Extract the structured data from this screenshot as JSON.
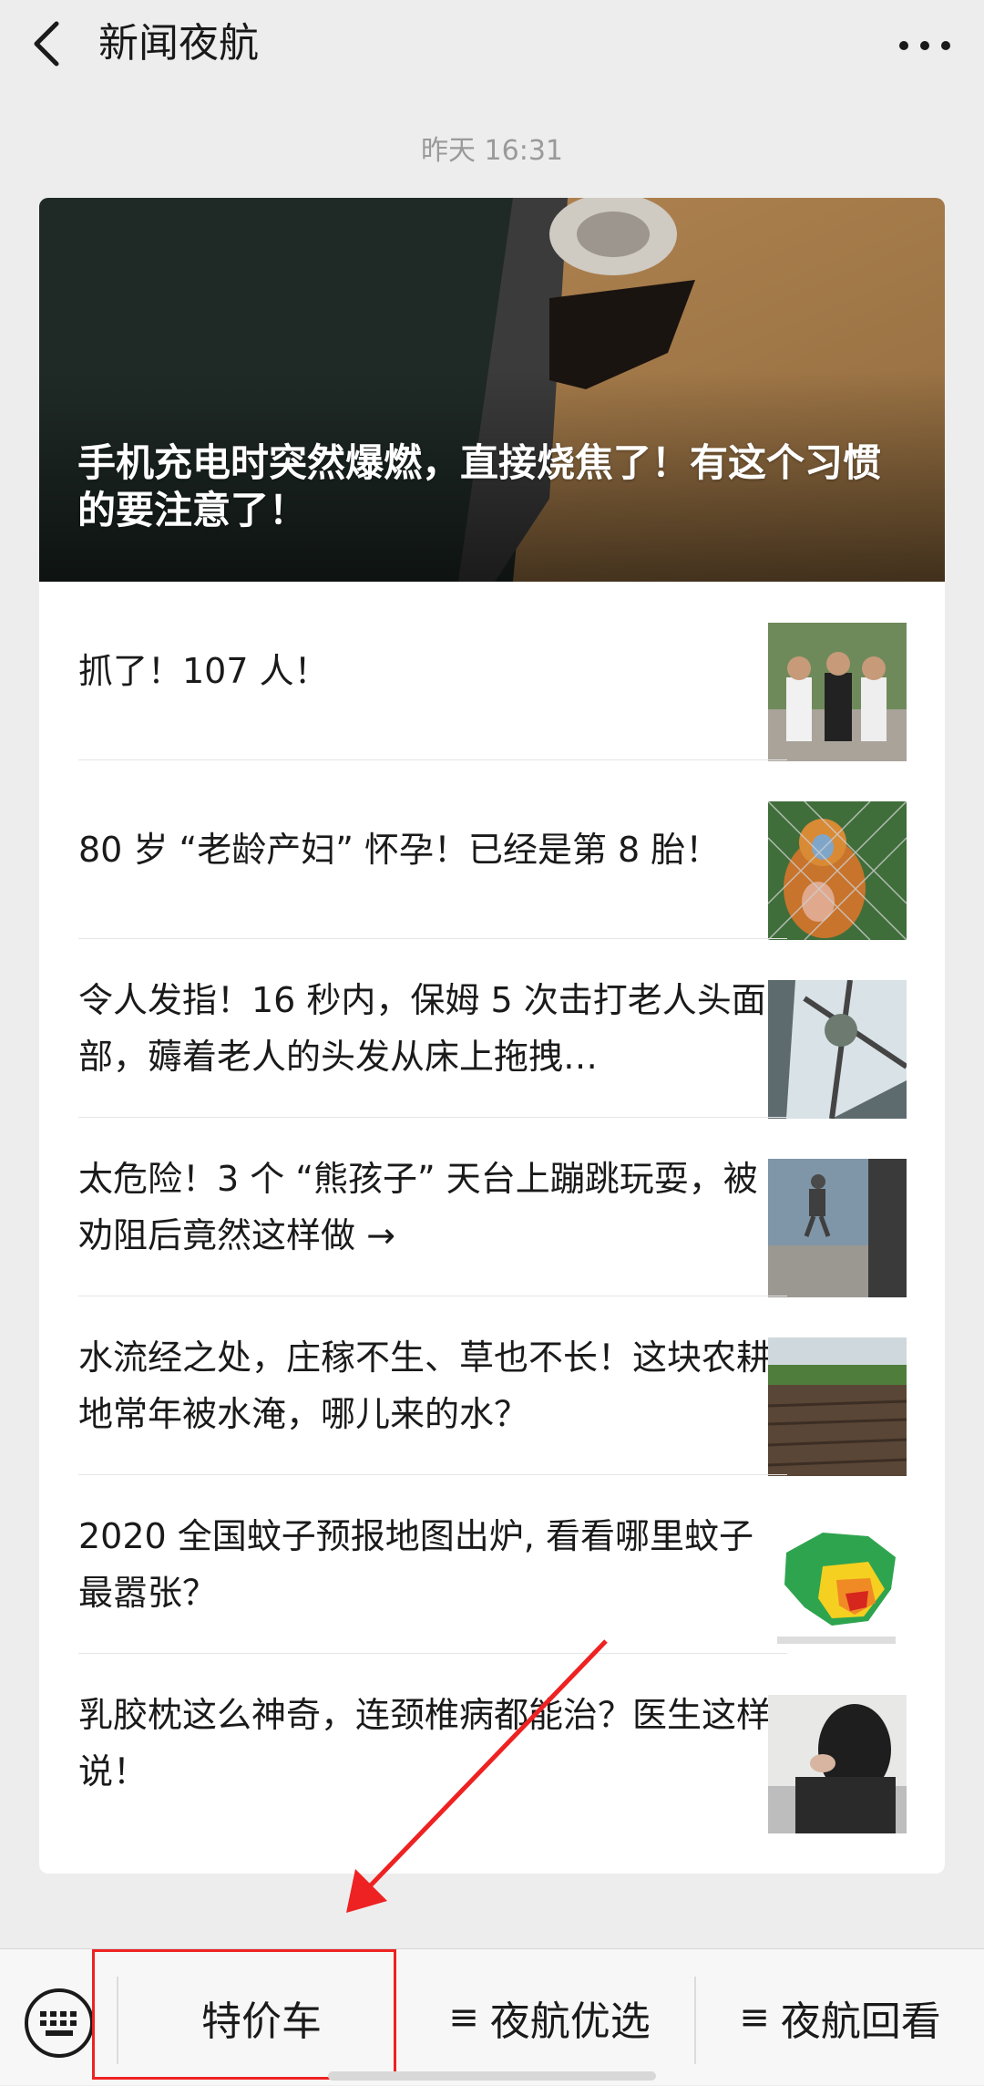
{
  "header": {
    "title": "新闻夜航",
    "back_icon": "chevron-left-icon",
    "more_icon": "more-dots-icon"
  },
  "timestamp": "昨天 16:31",
  "hero": {
    "title": "手机充电时突然爆燃，直接烧焦了！有这个习惯的要注意了！"
  },
  "articles": [
    {
      "title": "抓了！107 人！"
    },
    {
      "title": "80 岁 “老龄产妇” 怀孕！已经是第 8 胎！"
    },
    {
      "title": "令人发指！16 秒内，保姆 5 次击打老人头面部，薅着老人的头发从床上拖拽…"
    },
    {
      "title": "太危险！3 个 “熊孩子” 天台上蹦跳玩耍，被劝阻后竟然这样做 →"
    },
    {
      "title": "水流经之处，庄稼不生、草也不长！这块农耕地常年被水淹，哪儿来的水？"
    },
    {
      "title": "2020 全国蚊子预报地图出炉, 看看哪里蚊子最嚣张？"
    },
    {
      "title": "乳胶枕这么神奇，连颈椎病都能治？医生这样说！"
    }
  ],
  "bottom_menu": {
    "keyboard_icon": "keyboard-icon",
    "items": [
      {
        "label": "特价车",
        "has_submenu": false
      },
      {
        "label": "夜航优选",
        "has_submenu": true
      },
      {
        "label": "夜航回看",
        "has_submenu": true
      }
    ],
    "submenu_marker": "≡"
  },
  "annotation": {
    "color": "#ee2222",
    "target": "特价车"
  }
}
